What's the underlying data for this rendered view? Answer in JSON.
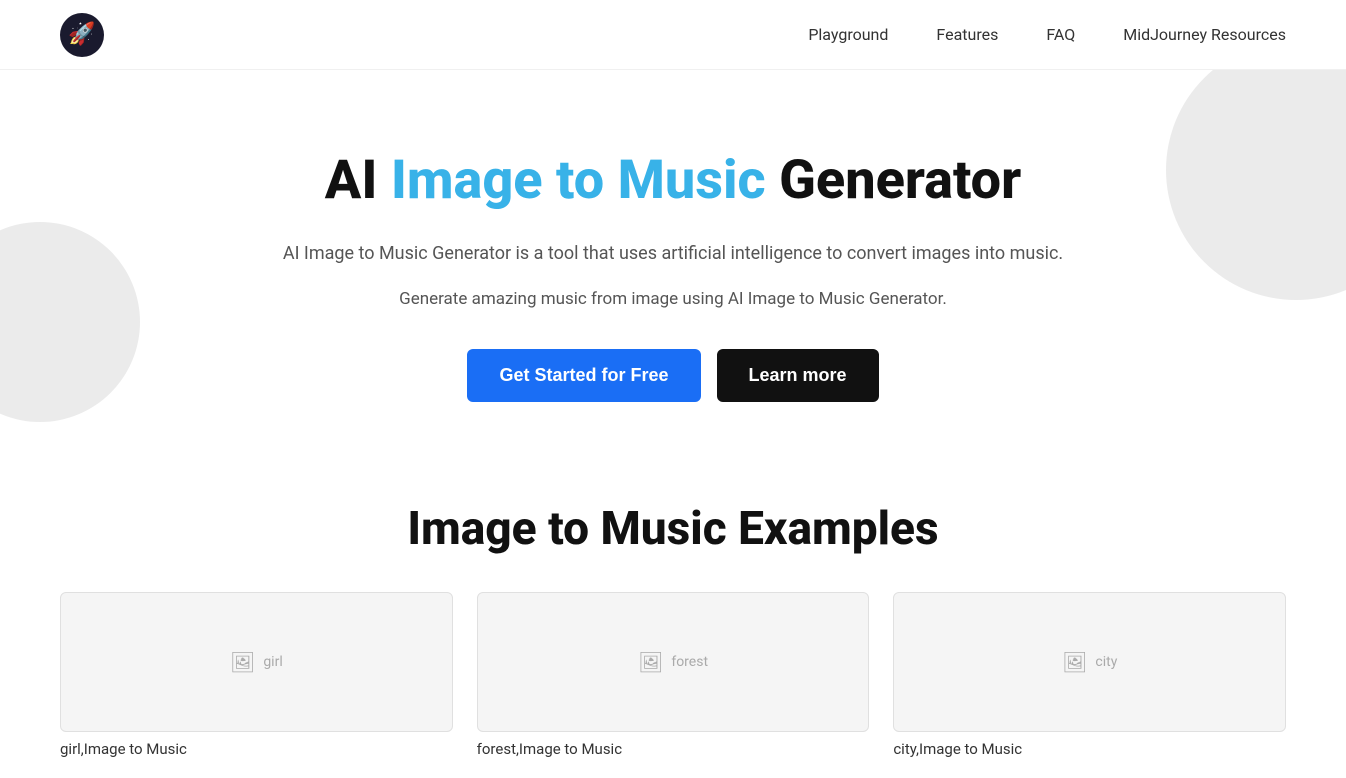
{
  "navbar": {
    "logo_emoji": "🚀",
    "links": [
      {
        "label": "Playground",
        "id": "playground"
      },
      {
        "label": "Features",
        "id": "features"
      },
      {
        "label": "FAQ",
        "id": "faq"
      },
      {
        "label": "MidJourney Resources",
        "id": "midjourney-resources"
      }
    ]
  },
  "hero": {
    "title_prefix": "AI ",
    "title_highlight": "Image to Music",
    "title_suffix": " Generator",
    "description": "AI Image to Music Generator is a tool that uses artificial intelligence to convert images into music.",
    "tagline": "Generate amazing music from image using AI Image to Music Generator.",
    "cta_primary": "Get Started for Free",
    "cta_secondary": "Learn more"
  },
  "examples": {
    "section_title": "Image to Music Examples",
    "items": [
      {
        "label": "girl,Image to Music",
        "alt": "girl"
      },
      {
        "label": "forest,Image to Music",
        "alt": "forest"
      },
      {
        "label": "city,Image to Music",
        "alt": "city"
      }
    ]
  }
}
